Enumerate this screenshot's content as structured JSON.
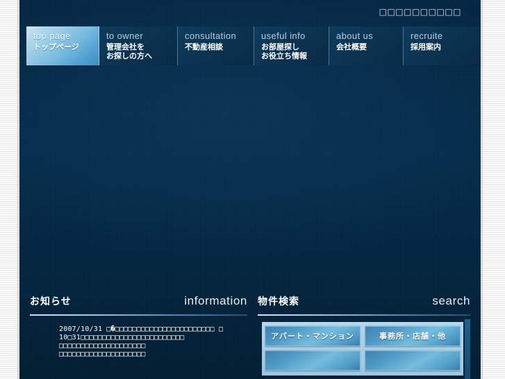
{
  "site": {
    "label": "□□□□□□□□□□"
  },
  "globalnav": {
    "items": [
      {
        "en": "top page",
        "jp": "トップページ",
        "active": true
      },
      {
        "en": "to owner",
        "jp": "管理会社を\nお探しの方へ",
        "active": false
      },
      {
        "en": "consultation",
        "jp": "不動産相談",
        "active": false
      },
      {
        "en": "useful info",
        "jp": "お部屋探し\nお役立ち情報",
        "active": false
      },
      {
        "en": "about us",
        "jp": "会社概要",
        "active": false
      },
      {
        "en": "recruite",
        "jp": "採用案内",
        "active": false
      }
    ]
  },
  "information": {
    "title_jp": "お知らせ",
    "title_en": "information",
    "news": [
      {
        "date": "2007/10/31",
        "line1": "□�□□□□□□□□□□□□□□□□□□□□□□□ □",
        "line2": "10□31□□□□□□□□□□□□□□□□□□□□□□□□",
        "line3": "□□□□□□□□□□□□□□□□□□□□",
        "line4": "□□□□□□□□□□□□□□□□□□□□"
      }
    ]
  },
  "search": {
    "title_jp": "物件検索",
    "title_en": "search",
    "buttons": [
      {
        "label": "アパート・マンション"
      },
      {
        "label": "事務所・店舗・他"
      }
    ],
    "buttons_row2": [
      {
        "label": ""
      },
      {
        "label": ""
      }
    ]
  },
  "colors": {
    "background_deep": "#042642",
    "accent_light": "#79bcdf",
    "rule": "#cfe2ef",
    "text": "#ffffff"
  }
}
